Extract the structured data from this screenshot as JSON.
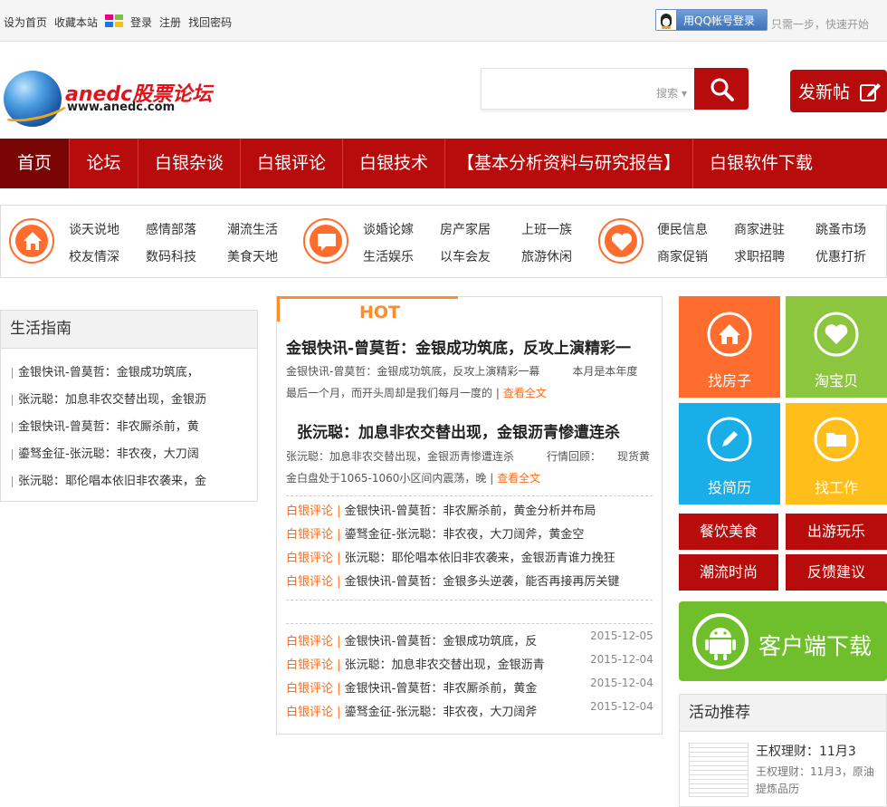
{
  "topbar": {
    "links": [
      "设为首页",
      "收藏本站"
    ],
    "auth": [
      "登录",
      "注册",
      "找回密码"
    ],
    "qq_login": "用QQ帐号登录",
    "qq_note": "只需一步，快速开始"
  },
  "header": {
    "logo_text": "anedc股票论坛",
    "logo_url": "www.anedc.com",
    "search_placeholder": "",
    "search_type": "搜索",
    "post_button": "发新帖"
  },
  "nav": {
    "items": [
      "首页",
      "论坛",
      "白银杂谈",
      "白银评论",
      "白银技术",
      "【基本分析资料与研究报告】",
      "白银软件下载"
    ]
  },
  "categories": {
    "group1": [
      "谈天说地",
      "感情部落",
      "潮流生活",
      "校友情深",
      "数码科技",
      "美食天地"
    ],
    "group2": [
      "谈婚论嫁",
      "房产家居",
      "上班一族",
      "生活娱乐",
      "以车会友",
      "旅游休闲"
    ],
    "group3": [
      "便民信息",
      "商家进驻",
      "跳蚤市场",
      "商家促销",
      "求职招聘",
      "优惠打折"
    ]
  },
  "life_guide": {
    "title": "生活指南",
    "items": [
      "金银快讯-曾莫哲：金银成功筑底，",
      "张沅聪：加息非农交替出现，金银沥",
      "金银快讯-曾莫哲：非农厮杀前，黄",
      "鎏驽金征-张沅聪：非农夜，大刀阔",
      "张沅聪：耶伦唱本依旧非农袭来，金"
    ]
  },
  "hot": {
    "label": "HOT",
    "article1": {
      "title": "金银快讯-曾莫哲：金银成功筑底，反攻上演精彩一",
      "summary1": "金银快讯-曾莫哲：金银成功筑底，反攻上演精彩一幕　　　本月是本年度",
      "summary2": "最后一个月，而开头周却是我们每月一度的 | ",
      "more": "查看全文"
    },
    "article2": {
      "title": "张沅聪：加息非农交替出现，金银沥青惨遭连杀",
      "summary1": "张沅聪：加息非农交替出现，金银沥青惨遭连杀　　　行情回顾：　　现货黄",
      "summary2": "金白盘处于1065-1060小区间内震荡，晚 | ",
      "more": "查看全文"
    },
    "tag": "白银评论 |",
    "list": [
      "金银快讯-曾莫哲：非农厮杀前，黄金分析并布局",
      "鎏驽金征-张沅聪：非农夜，大刀阔斧，黄金空",
      "张沅聪：耶伦唱本依旧非农袭来，金银沥青谁力挽狂",
      "金银快讯-曾莫哲：金银多头逆袭，能否再接再厉关键"
    ],
    "dated": [
      {
        "text": "金银快讯-曾莫哲：金银成功筑底，反",
        "date": "2015-12-05"
      },
      {
        "text": "张沅聪：加息非农交替出现，金银沥青",
        "date": "2015-12-04"
      },
      {
        "text": "金银快讯-曾莫哲：非农厮杀前，黄金",
        "date": "2015-12-04"
      },
      {
        "text": "鎏驽金征-张沅聪：非农夜，大刀阔斧",
        "date": "2015-12-04"
      }
    ]
  },
  "tiles": {
    "house": "找房子",
    "treasure": "淘宝贝",
    "resume": "投简历",
    "job": "找工作",
    "buttons": [
      "餐饮美食",
      "出游玩乐",
      "潮流时尚",
      "反馈建议"
    ],
    "download": "客户端下载"
  },
  "activity": {
    "title": "活动推荐",
    "item_title": "王权理财：11月3",
    "item_summary": "王权理财：11月3，原油提炼品历"
  },
  "colors": {
    "brand_red": "#b80c0c",
    "accent_orange": "#ff6d1a",
    "tile_orange": "#ff6d2e",
    "tile_green": "#8cc63f",
    "tile_blue": "#1aaee8",
    "tile_yellow": "#ffbe1a"
  }
}
